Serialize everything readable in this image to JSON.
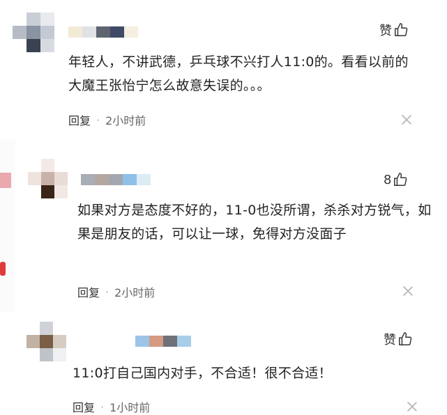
{
  "comments": [
    {
      "text": "年轻人，不讲武德，乒乓球不兴打人11:0的。看看以前的大魔王张怡宁怎么故意失误的。。。",
      "like_label": "赞",
      "reply_label": "回复",
      "separator": "·",
      "time": "2小时前"
    },
    {
      "text": "如果对方是态度不好的，11-0也没所谓，杀杀对方锐气，如果是朋友的话，可以让一球，免得对方没面子",
      "like_label": "8",
      "reply_label": "回复",
      "separator": "·",
      "time": "2小时前"
    },
    {
      "text": "11:0打自己国内对手，不合适！很不合适！",
      "like_label": "赞",
      "reply_label": "回复",
      "separator": "·",
      "time": "1小时前"
    }
  ],
  "colors": {
    "accent_red": "#e03b3b",
    "text": "#222222",
    "meta": "#666666"
  },
  "icons": [
    "thumbs-up-icon",
    "close-icon"
  ]
}
